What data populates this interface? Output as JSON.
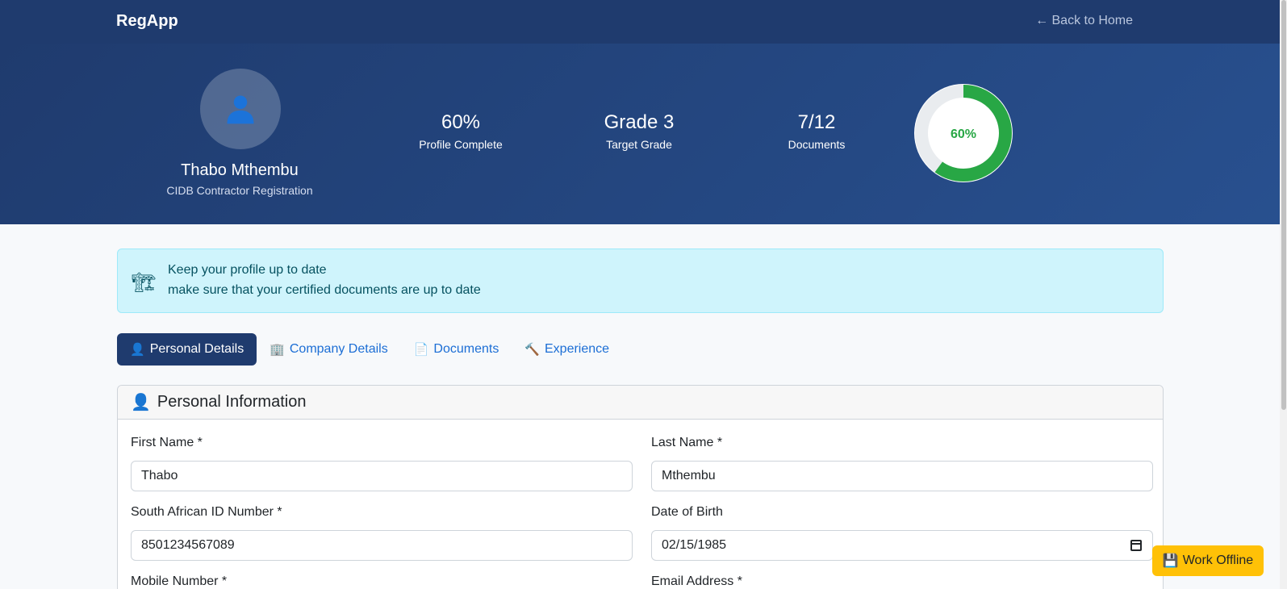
{
  "navbar": {
    "brand": "RegApp",
    "back_link": "← Back to Home"
  },
  "profile": {
    "avatar_icon": "user-icon",
    "name": "Thabo Mthembu",
    "subtitle": "CIDB Contractor Registration"
  },
  "stats": [
    {
      "value": "60%",
      "label": "Profile Complete"
    },
    {
      "value": "Grade 3",
      "label": "Target Grade"
    },
    {
      "value": "7/12",
      "label": "Documents"
    }
  ],
  "progress_ring": {
    "percent": 60,
    "label": "60%",
    "color": "#28a745",
    "track_color": "#e9ecef"
  },
  "alert": {
    "icon": "crane-icon",
    "line1": "Keep your profile up to date",
    "line2": "make sure that your certified documents are up to date"
  },
  "tabs": [
    {
      "icon": "👤",
      "label": "Personal Details",
      "active": true
    },
    {
      "icon": "🏢",
      "label": "Company Details",
      "active": false
    },
    {
      "icon": "📄",
      "label": "Documents",
      "active": false
    },
    {
      "icon": "🔨",
      "label": "Experience",
      "active": false
    }
  ],
  "personal_info": {
    "header_icon": "👤",
    "title": "Personal Information",
    "fields": {
      "first_name": {
        "label": "First Name *",
        "value": "Thabo"
      },
      "last_name": {
        "label": "Last Name *",
        "value": "Mthembu"
      },
      "id_number": {
        "label": "South African ID Number *",
        "value": "8501234567089"
      },
      "dob": {
        "label": "Date of Birth",
        "value": "02/15/1985"
      },
      "mobile": {
        "label": "Mobile Number *"
      },
      "email": {
        "label": "Email Address *"
      }
    }
  },
  "offline_button": {
    "icon": "💾",
    "label": "Work Offline"
  },
  "colors": {
    "navy": "#1f3b6e",
    "link": "#1c6ed5",
    "alert_bg": "#cff4fc",
    "warning": "#ffc107"
  }
}
